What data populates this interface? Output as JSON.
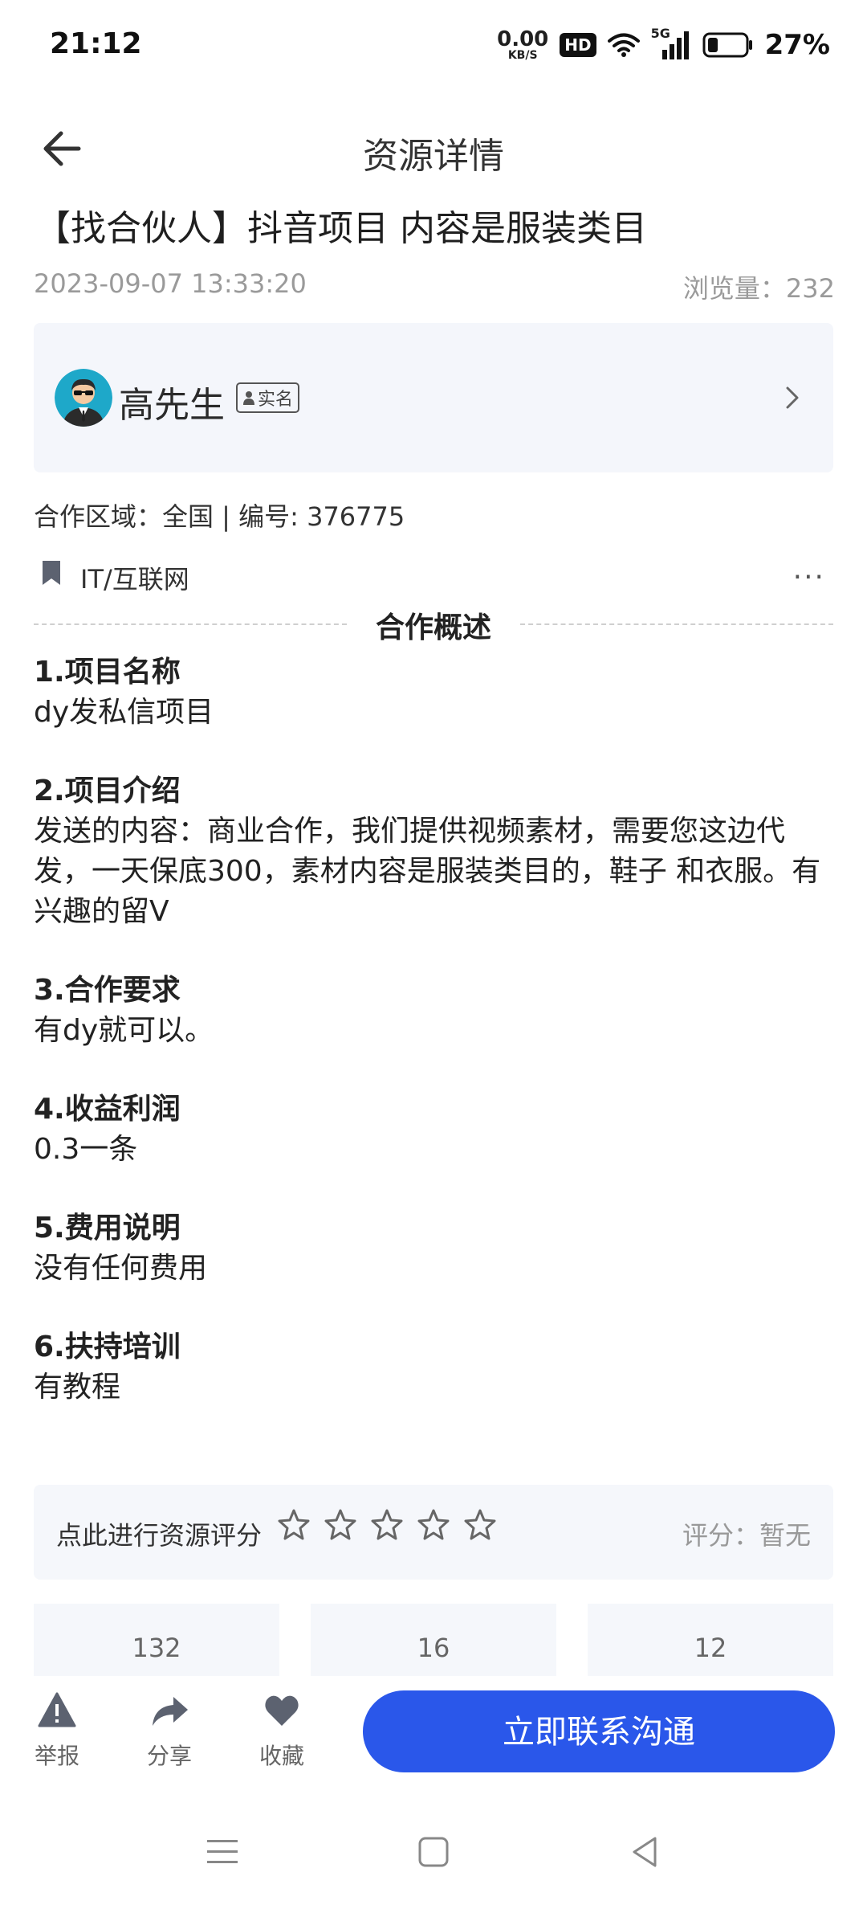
{
  "status_bar": {
    "time": "21:12",
    "net_speed_value": "0.00",
    "net_speed_unit": "KB/S",
    "hd_label": "HD",
    "signal_label": "5G",
    "battery": "27%"
  },
  "header": {
    "title": "资源详情"
  },
  "resource": {
    "title": "【找合伙人】抖音项目 内容是服装类目",
    "date": "2023-09-07 13:33:20",
    "views": "浏览量：232",
    "author": {
      "name": "高先生",
      "badge": "实名"
    },
    "coop_info": "合作区域：全国 | 编号: 376775",
    "category": "IT/互联网",
    "more": "···"
  },
  "overview": {
    "title": "合作概述",
    "sections": [
      {
        "heading": "1.项目名称",
        "body": "dy发私信项目"
      },
      {
        "heading": "2.项目介绍",
        "body": "发送的内容：商业合作，我们提供视频素材，需要您这边代发，一天保底300，素材内容是服装类目的，鞋子 和衣服。有兴趣的留V"
      },
      {
        "heading": "3.合作要求",
        "body": "有dy就可以。"
      },
      {
        "heading": "4.收益利润",
        "body": "0.3一条"
      },
      {
        "heading": "5.费用说明",
        "body": "没有任何费用"
      },
      {
        "heading": "6.扶持培训",
        "body": "有教程"
      }
    ]
  },
  "rating": {
    "prompt": "点此进行资源评分",
    "stars_total": 5,
    "score": "评分：暂无"
  },
  "stats": {
    "values": [
      "132",
      "16",
      "12"
    ]
  },
  "bottom_bar": {
    "report": "举报",
    "share": "分享",
    "favorite": "收藏",
    "contact": "立即联系沟通"
  },
  "colors": {
    "accent": "#2a57ea",
    "card_bg": "#f4f6fb",
    "muted_text": "#9a9a9a"
  }
}
